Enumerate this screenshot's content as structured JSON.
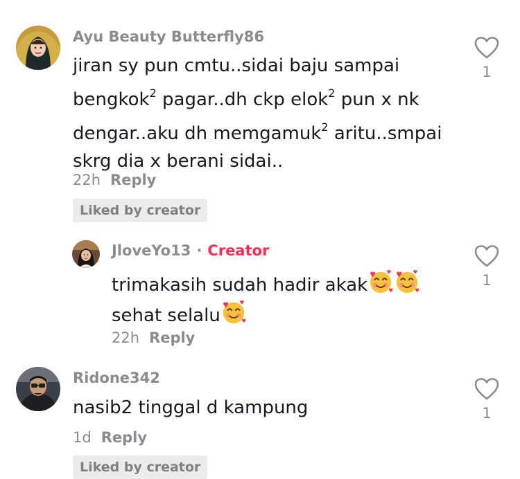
{
  "comments": [
    {
      "username": "Ayu Beauty Butterfly86",
      "lines": [
        "jiran sy pun cmtu..sidai baju sampai",
        "bengkok² pagar..dh ckp elok² pun x nk",
        "dengar..aku dh memgamuk² aritu..smpai",
        "skrg dia x berani sidai.."
      ],
      "time": "22h",
      "reply_label": "Reply",
      "badge": "Liked by creator",
      "likes": "1"
    },
    {
      "username": "JloveYo13",
      "separator": "·",
      "tag": "Creator",
      "lines": [
        "trimakasih sudah hadir akak",
        "sehat selalu"
      ],
      "time": "22h",
      "reply_label": "Reply",
      "likes": "1"
    },
    {
      "username": "Ridone342",
      "lines": [
        "nasib2 tinggal d kampung"
      ],
      "time": "1d",
      "reply_label": "Reply",
      "badge": "Liked by creator",
      "likes": "1"
    }
  ],
  "colors": {
    "creator_tag": "#fe2c55",
    "muted": "#8a8b91",
    "badge_bg": "#ebebeb",
    "text": "#161823"
  },
  "icons": [
    "heart-outline-icon",
    "smiling-face-with-hearts-emoji"
  ]
}
